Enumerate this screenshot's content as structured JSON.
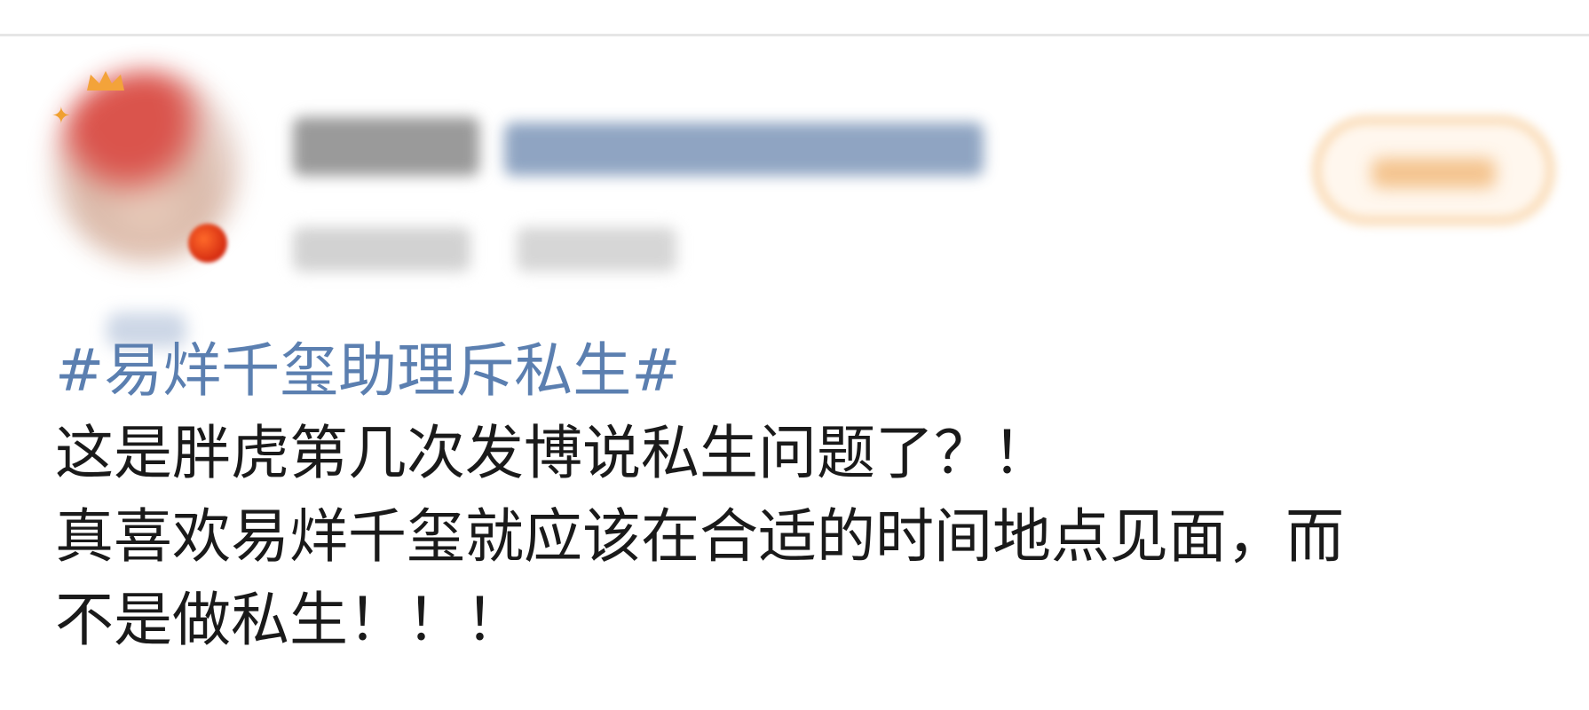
{
  "post": {
    "topic": "#易烊千玺助理斥私生#",
    "lines": [
      "这是胖虎第几次发博说私生问题了？！",
      "真喜欢易烊千玺就应该在合适的时间地点见面，而",
      "不是做私生！！！"
    ]
  },
  "icons": {
    "sparkle": "sparkle-icon",
    "crown": "crown-icon"
  },
  "colors": {
    "topic": "#5b7fb0",
    "text": "#1a1a1a",
    "divider": "#e6e6e6",
    "follow_border": "#f6c58a"
  }
}
